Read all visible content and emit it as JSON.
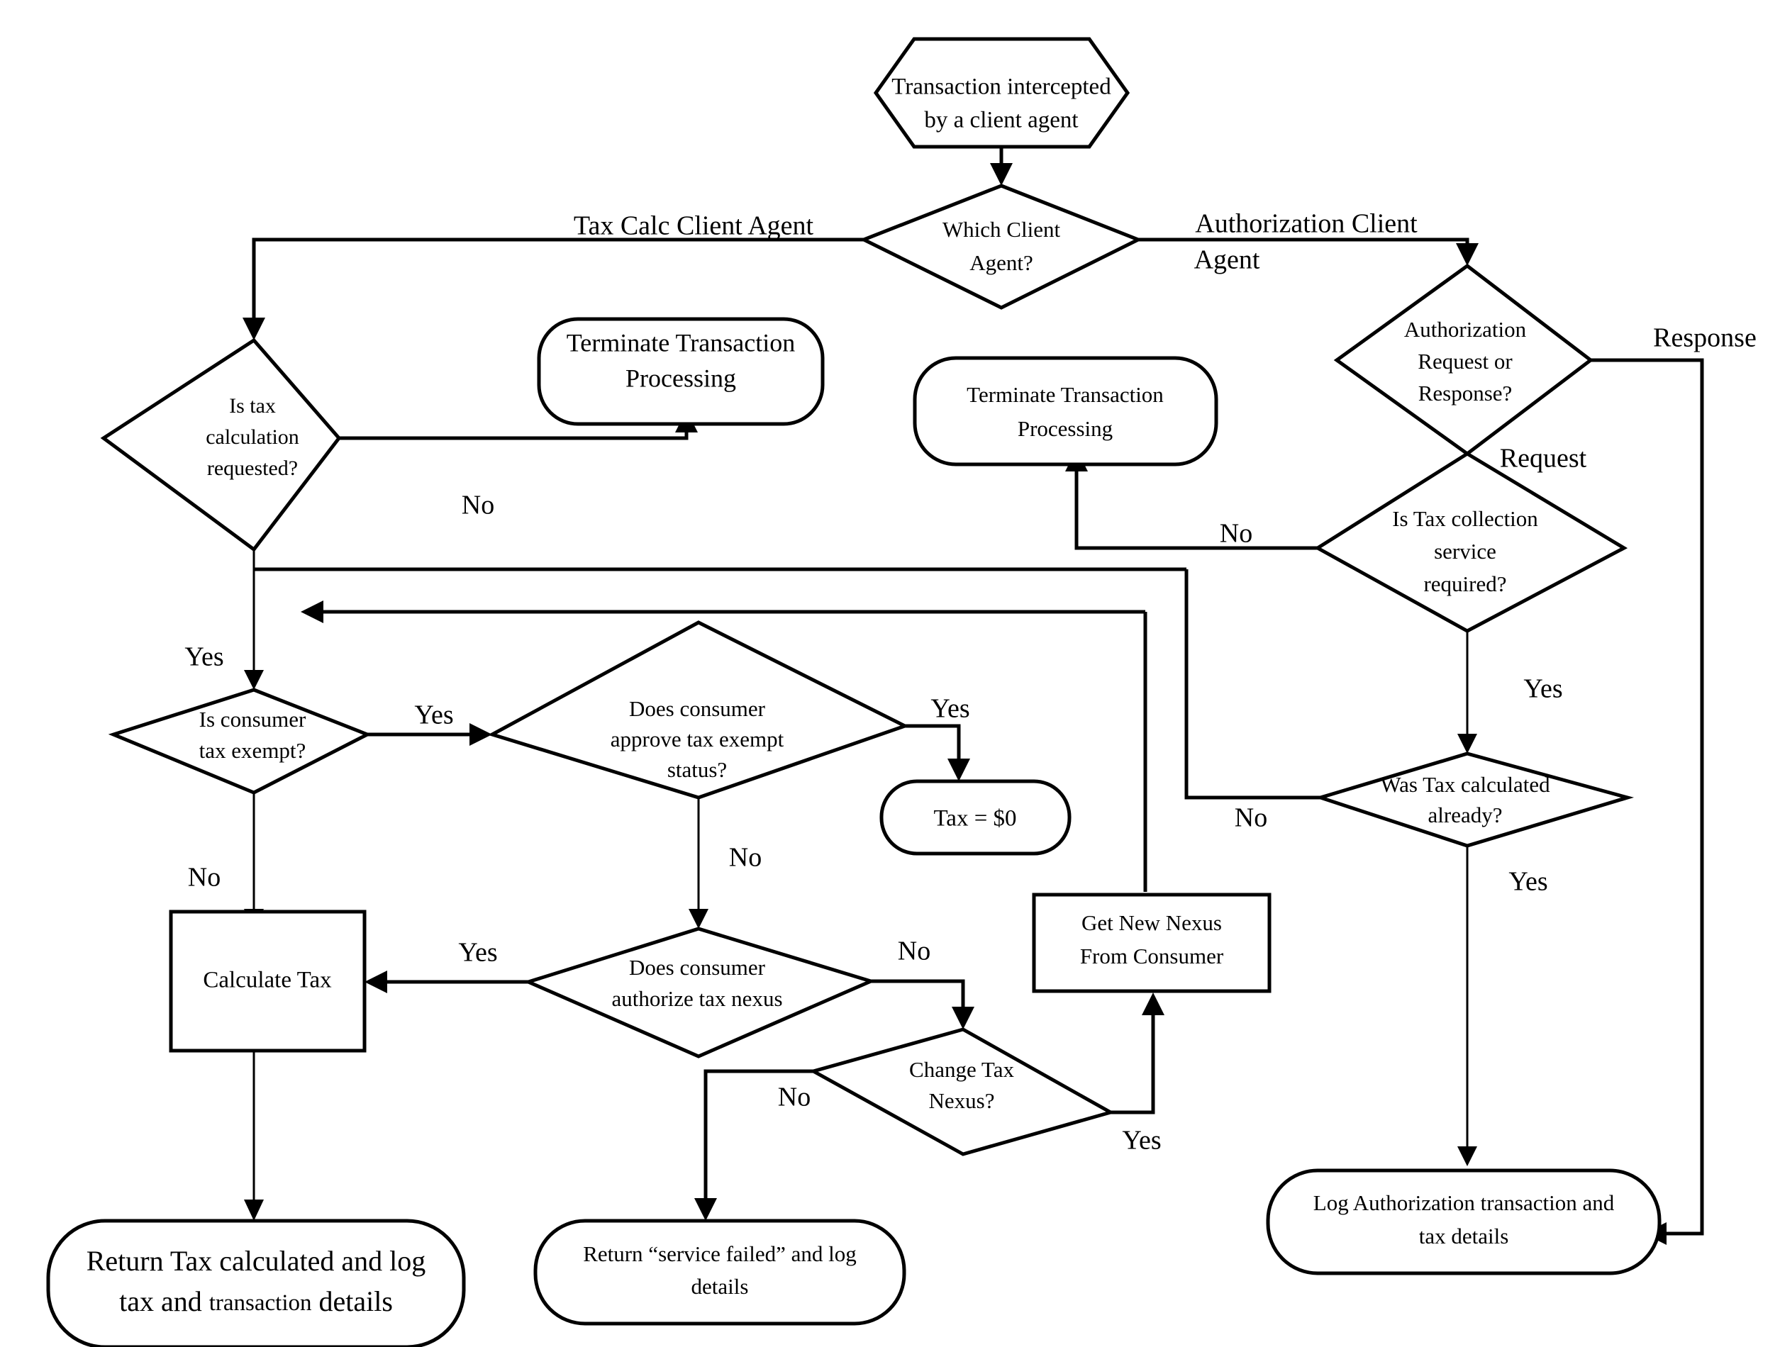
{
  "diagram": {
    "title": "Tax Calculation and Authorization Client Agent Flowchart",
    "type": "flowchart",
    "background_color": "#ffffff",
    "line_color": "#000000"
  },
  "nodes": {
    "start": {
      "shape": "hexagon",
      "line1": "Transaction intercepted",
      "line2": "by a  client agent"
    },
    "which_client_agent": {
      "shape": "diamond",
      "line1": "Which Client",
      "line2": "Agent?"
    },
    "is_tax_calc_requested": {
      "shape": "diamond",
      "line1": "Is tax",
      "line2": "calculation",
      "line3": "requested?"
    },
    "terminate_left": {
      "shape": "rounded",
      "line1": "Terminate Transaction",
      "line2": "Processing"
    },
    "terminate_mid": {
      "shape": "rounded",
      "line1": "Terminate Transaction",
      "line2": "Processing"
    },
    "auth_request_or_response": {
      "shape": "diamond",
      "line1": "Authorization",
      "line2": "Request or",
      "line3": "Response?"
    },
    "is_tax_collection_required": {
      "shape": "diamond",
      "line1": "Is Tax collection",
      "line2": "service",
      "line3": "required?"
    },
    "is_consumer_tax_exempt": {
      "shape": "diamond",
      "line1": "Is consumer",
      "line2": "tax exempt?"
    },
    "does_consumer_approve": {
      "shape": "diamond",
      "line1": "Does consumer",
      "line2": "approve tax exempt",
      "line3": "status?"
    },
    "tax_zero": {
      "shape": "rounded",
      "line1": "Tax = $0"
    },
    "was_tax_calculated": {
      "shape": "diamond",
      "line1": "Was Tax calculated",
      "line2": "already?"
    },
    "calculate_tax": {
      "shape": "rect",
      "line1": "Calculate Tax"
    },
    "does_consumer_authorize_nexus": {
      "shape": "diamond",
      "line1": "Does consumer",
      "line2": "authorize tax nexus"
    },
    "get_new_nexus": {
      "shape": "rect",
      "line1": "Get New Nexus",
      "line2": "From Consumer"
    },
    "change_tax_nexus": {
      "shape": "diamond",
      "line1": "Change Tax",
      "line2": "Nexus?"
    },
    "return_tax_calculated": {
      "shape": "rounded",
      "line1": "Return Tax calculated and log",
      "line2a": "tax and ",
      "line2b": "transaction",
      "line2c": " details"
    },
    "return_service_failed": {
      "shape": "rounded",
      "line1": "Return “service failed” and log",
      "line2": "details"
    },
    "log_authorization": {
      "shape": "rounded",
      "line1": "Log Authorization transaction and",
      "line2": "tax details"
    }
  },
  "edge_labels": {
    "tax_calc_client_agent": "Tax Calc Client Agent",
    "authorization_client_agent_l1": "Authorization Client",
    "authorization_client_agent_l2": "Agent",
    "response": "Response",
    "request": "Request",
    "no_is_tax_calc": "No",
    "yes_is_tax_calc": "Yes",
    "no_tax_collection": "No",
    "yes_tax_collection": "Yes",
    "no_was_tax_calculated": "No",
    "yes_was_tax_calculated": "Yes",
    "yes_consumer_exempt": "Yes",
    "no_consumer_exempt": "No",
    "yes_approve_exempt": "Yes",
    "no_approve_exempt": "No",
    "yes_authorize_nexus": "Yes",
    "no_authorize_nexus": "No",
    "no_change_nexus": "No",
    "yes_change_nexus": "Yes"
  }
}
